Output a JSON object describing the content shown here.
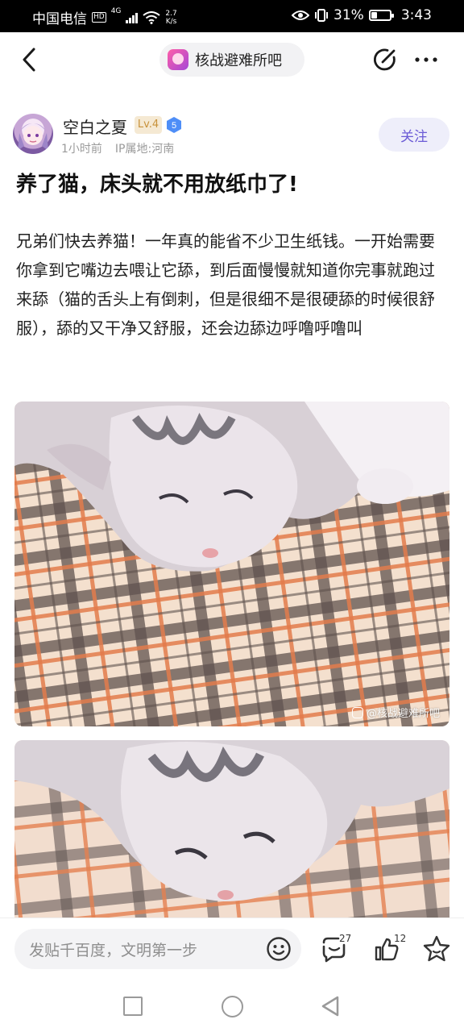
{
  "status_bar": {
    "carrier": "中国电信",
    "hd": "HD",
    "network": "4G",
    "speed_value": "2.7",
    "speed_unit": "K/s",
    "battery_percent": "31%",
    "battery_level": 0.31,
    "time": "3:43"
  },
  "header": {
    "forum_name": "核战避难所吧"
  },
  "author": {
    "name": "空白之夏",
    "level": "Lv.4",
    "badge": "5",
    "time_ago": "1小时前",
    "ip_location": "IP属地:河南",
    "follow_label": "关注"
  },
  "post": {
    "title": "养了猫，床头就不用放纸巾了!",
    "body": "兄弟们快去养猫！一年真的能省不少卫生纸钱。一开始需要你拿到它嘴边去喂让它舔，到后面慢慢就知道你完事就跑过来舔（猫的舌头上有倒刺，但是很细不是很硬舔的时候很舒服），舔的又干净又舒服，还会边舔边呼噜呼噜叫",
    "watermark": "@核战避难所吧"
  },
  "bottom_bar": {
    "reply_placeholder": "发贴千百度，文明第一步",
    "comment_count": "27",
    "like_count": "12"
  },
  "colors": {
    "accent": "#6b5bd6",
    "level_text": "#c8923b",
    "badge_blue": "#4e8ef7"
  }
}
